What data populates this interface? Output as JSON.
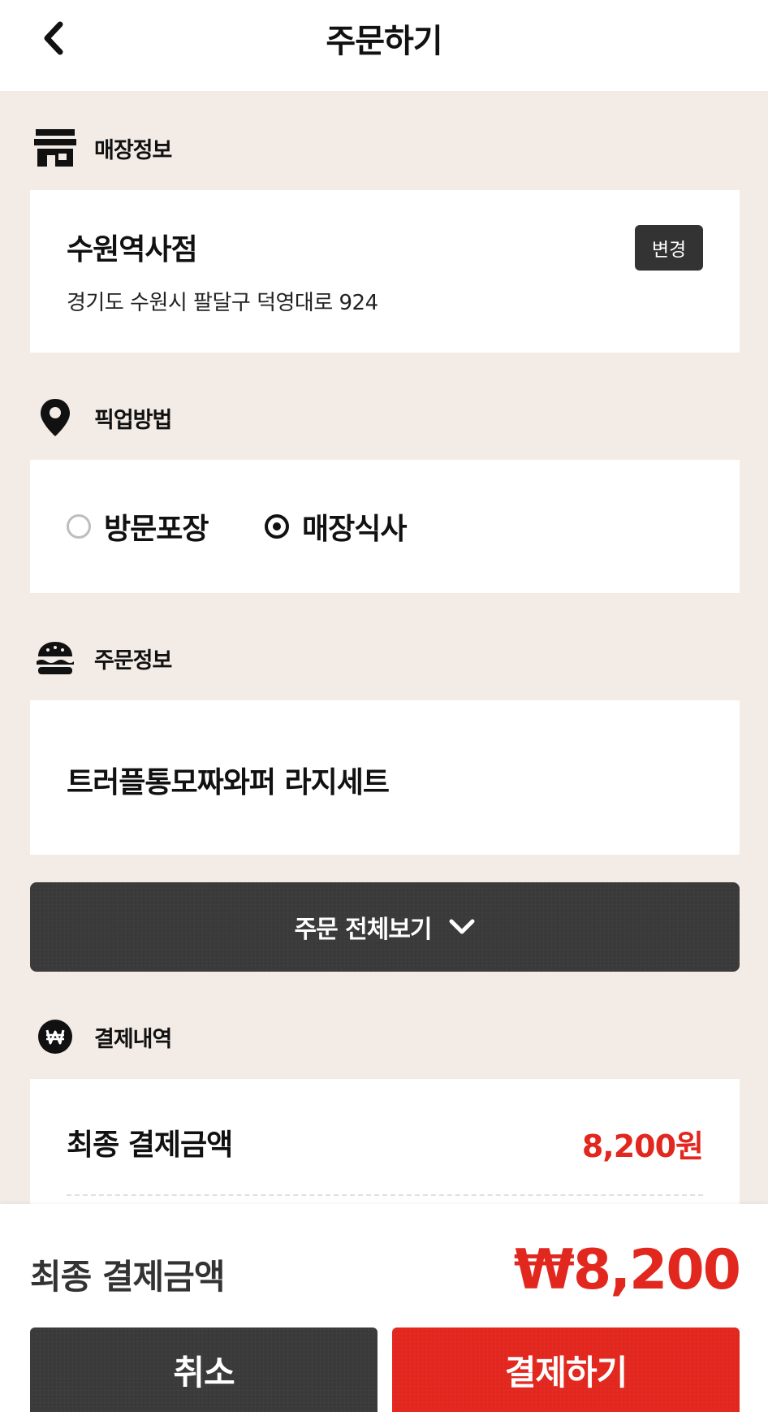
{
  "header": {
    "title": "주문하기"
  },
  "store": {
    "section_label": "매장정보",
    "name": "수원역사점",
    "address": "경기도 수원시 팔달구 덕영대로 924",
    "change_label": "변경"
  },
  "pickup": {
    "section_label": "픽업방법",
    "options": [
      {
        "label": "방문포장",
        "selected": false
      },
      {
        "label": "매장식사",
        "selected": true
      }
    ]
  },
  "order": {
    "section_label": "주문정보",
    "item": "트러플통모짜와퍼 라지세트",
    "view_all_label": "주문 전체보기"
  },
  "payment": {
    "section_label": "결제내역",
    "final_label": "최종 결제금액",
    "final_value": "8,200원"
  },
  "bottom": {
    "final_label": "최종 결제금액",
    "final_total": "₩8,200",
    "cancel_label": "취소",
    "pay_label": "결제하기"
  },
  "colors": {
    "accent": "#e2271f",
    "dark": "#3a3a3a",
    "background": "#f3ebe6"
  }
}
